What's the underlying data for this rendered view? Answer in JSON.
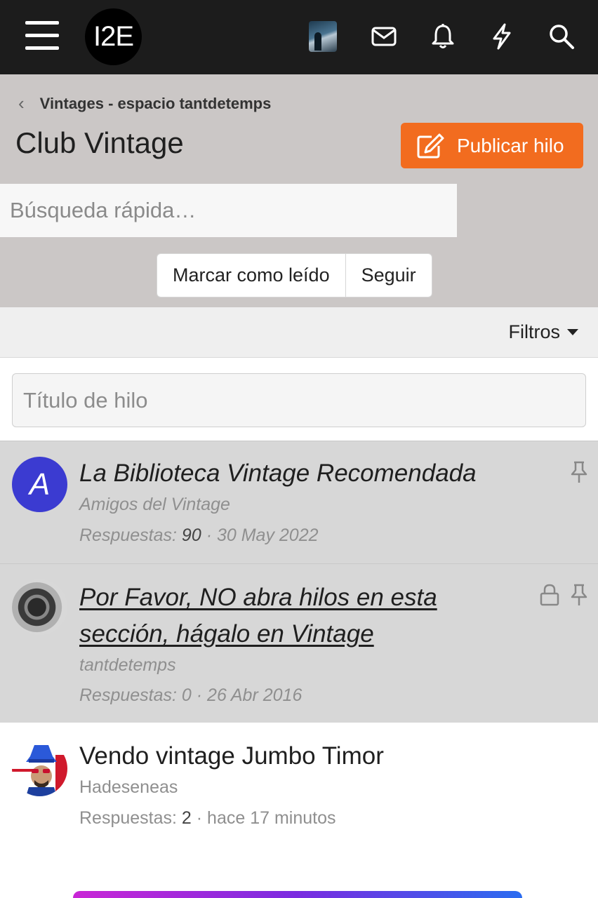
{
  "topbar": {
    "logo_text": "I2E",
    "icons": [
      "menu-icon",
      "avatar",
      "mail-icon",
      "bell-icon",
      "lightning-icon",
      "search-icon"
    ]
  },
  "header": {
    "breadcrumb": "Vintages - espacio tantdetemps",
    "title": "Club Vintage",
    "publish_label": "Publicar hilo",
    "quick_search_placeholder": "Búsqueda rápida…",
    "mark_read_label": "Marcar como leído",
    "follow_label": "Seguir"
  },
  "filters": {
    "label": "Filtros",
    "title_placeholder": "Título de hilo"
  },
  "threads": [
    {
      "avatar_letter": "A",
      "title": "La Biblioteca Vintage Recomendada",
      "author": "Amigos del Vintage",
      "replies_label": "Respuestas:",
      "replies": "90",
      "date": "· 30 May 2022",
      "sticky": true,
      "locked": false
    },
    {
      "title": "Por Favor, NO abra hilos en esta sección, hágalo en Vintage",
      "author": "tantdetemps",
      "replies_label": "Respuestas:",
      "replies": "0",
      "date": "· 26 Abr 2016",
      "sticky": true,
      "locked": true
    },
    {
      "title": "Vendo vintage Jumbo Timor",
      "author": "Hadeseneas",
      "replies_label": "Respuestas:",
      "replies": "2",
      "date": "· hace 17 minutos",
      "sticky": false,
      "locked": false
    }
  ],
  "colors": {
    "topbar": "#1c1c1c",
    "header_bg": "#cbc7c6",
    "accent": "#f26c1f",
    "avatar_a": "#3b3bd1"
  }
}
